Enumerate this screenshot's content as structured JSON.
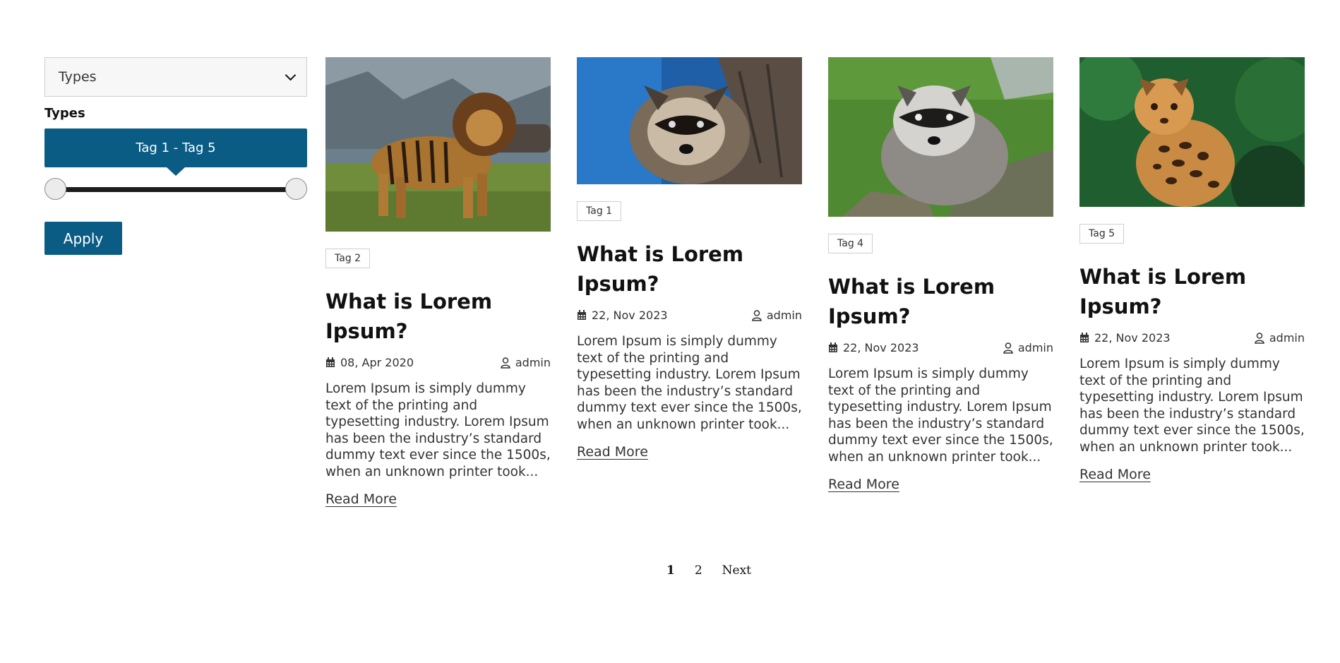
{
  "filter": {
    "select_label": "Types",
    "heading": "Types",
    "range_label": "Tag 1 - Tag 5",
    "range_min": 1,
    "range_max": 5,
    "apply_label": "Apply"
  },
  "posts": [
    {
      "tag": "Tag 2",
      "title": "What is Lorem Ipsum?",
      "date": "08, Apr 2020",
      "author": "admin",
      "excerpt": "Lorem Ipsum is simply dummy text of the printing and typesetting industry. Lorem Ipsum has been the industry’s standard dummy text ever since the 1500s, when an unknown printer took...",
      "read_more": "Read More"
    },
    {
      "tag": "Tag 1",
      "title": "What is Lorem Ipsum?",
      "date": "22, Nov 2023",
      "author": "admin",
      "excerpt": "Lorem Ipsum is simply dummy text of the printing and typesetting industry. Lorem Ipsum has been the industry’s standard dummy text ever since the 1500s, when an unknown printer took...",
      "read_more": "Read More"
    },
    {
      "tag": "Tag 4",
      "title": "What is Lorem Ipsum?",
      "date": "22, Nov 2023",
      "author": "admin",
      "excerpt": "Lorem Ipsum is simply dummy text of the printing and typesetting industry. Lorem Ipsum has been the industry’s standard dummy text ever since the 1500s, when an unknown printer took...",
      "read_more": "Read More"
    },
    {
      "tag": "Tag 5",
      "title": "What is Lorem Ipsum?",
      "date": "22, Nov 2023",
      "author": "admin",
      "excerpt": "Lorem Ipsum is simply dummy text of the printing and typesetting industry. Lorem Ipsum has been the industry’s standard dummy text ever since the 1500s, when an unknown printer took...",
      "read_more": "Read More"
    }
  ],
  "pagination": {
    "pages": [
      "1",
      "2"
    ],
    "current": "1",
    "next": "Next"
  },
  "colors": {
    "accent": "#0b5c85"
  }
}
